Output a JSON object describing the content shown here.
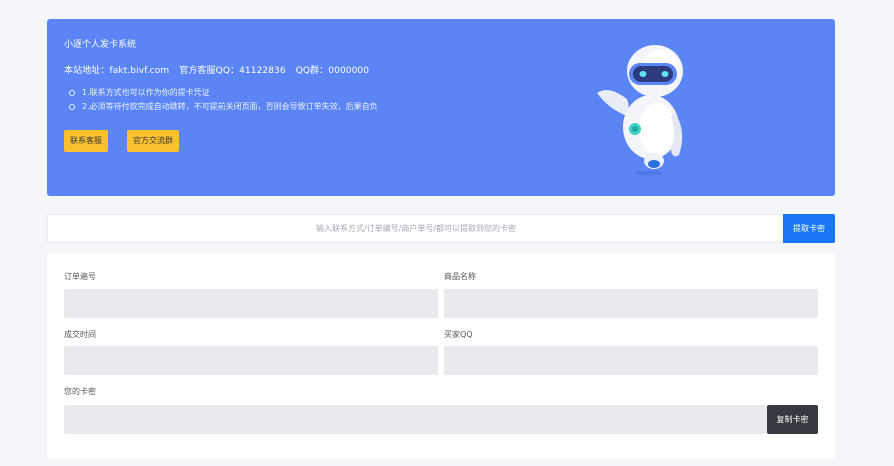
{
  "banner": {
    "title": "小逐个人发卡系统",
    "site_label": "本站地址：fakt.bivf.com",
    "qq_service": "官方客服QQ：41122836",
    "qq_group": "QQ群：0000000",
    "notes": [
      "1.联系方式也可以作为你的提卡凭证",
      "2.必须等待付款完成自动跳转，不可提前关闭页面，否则会导致订单失效，后果自负"
    ],
    "contact_button": "联系客服",
    "group_button": "官方交流群"
  },
  "search": {
    "placeholder": "输入联系方式/订单编号/商户单号/都可以提取到您的卡密",
    "button": "提取卡密"
  },
  "order": {
    "order_no_label": "订单遍号",
    "product_label": "商品名称",
    "time_label": "成交时间",
    "buyer_qq_label": "买家QQ",
    "card_label": "您的卡密",
    "copy_button": "复制卡密",
    "order_no": "",
    "product": "",
    "time": "",
    "buyer_qq": "",
    "card": ""
  },
  "colors": {
    "banner_bg": "#5b84f4",
    "accent_button": "#fbc02d",
    "primary": "#1976f2",
    "dark_button": "#343a40"
  }
}
